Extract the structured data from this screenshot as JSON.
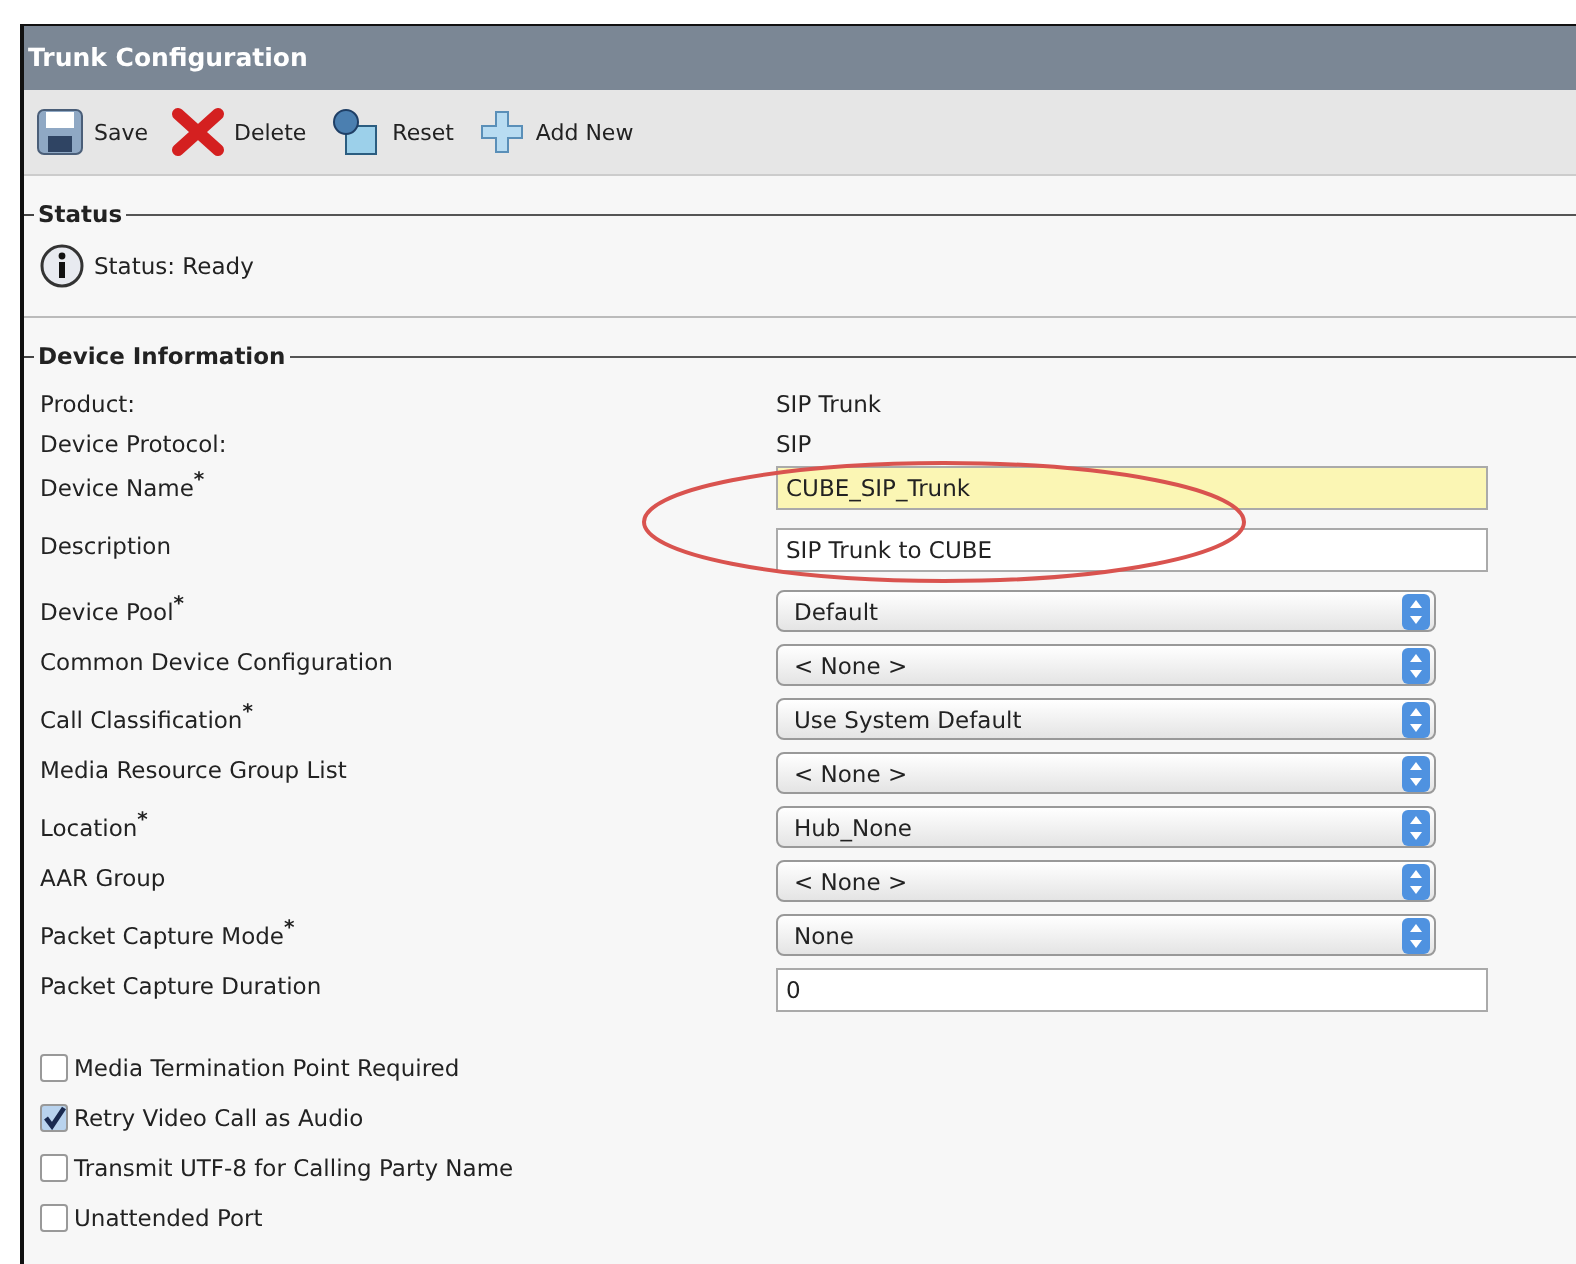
{
  "window": {
    "title": "Trunk Configuration"
  },
  "toolbar": [
    {
      "kind": "save",
      "label": "Save"
    },
    {
      "kind": "delete",
      "label": "Delete"
    },
    {
      "kind": "reset",
      "label": "Reset"
    },
    {
      "kind": "add",
      "label": "Add New"
    }
  ],
  "status": {
    "legend": "Status",
    "text": "Status: Ready"
  },
  "device_information": {
    "legend": "Device Information",
    "rows": [
      {
        "kind": "text",
        "label": "Product:",
        "value": "SIP Trunk"
      },
      {
        "kind": "text",
        "label": "Device Protocol:",
        "value": "SIP"
      },
      {
        "kind": "input",
        "label": "Device Name$^{*}$",
        "value": "CUBE_SIP_Trunk",
        "highlighted": true
      },
      {
        "kind": "input",
        "label": "Description",
        "value": "SIP Trunk to CUBE",
        "highlighted": false
      },
      {
        "kind": "select",
        "label": "Device Pool$^{*}$",
        "value": "Default"
      },
      {
        "kind": "select",
        "label": "Common Device Configuration",
        "value": "< None >"
      },
      {
        "kind": "select",
        "label": "Call Classification$^{*}$",
        "value": "Use System Default"
      },
      {
        "kind": "select",
        "label": "Media Resource Group List",
        "value": "< None >"
      },
      {
        "kind": "select",
        "label": "Location$^{*}$",
        "value": "Hub_None"
      },
      {
        "kind": "select",
        "label": "AAR Group",
        "value": "< None >"
      },
      {
        "kind": "select",
        "label": "Packet Capture Mode$^{*}$",
        "value": "None"
      },
      {
        "kind": "input",
        "label": "Packet Capture Duration",
        "value": "0",
        "highlighted": false
      }
    ],
    "checkboxes": [
      {
        "label": "Media Termination Point Required",
        "checked": false
      },
      {
        "label": "Retry Video Call as Audio",
        "checked": true
      },
      {
        "label": "Transmit UTF-8 for Calling Party Name",
        "checked": false
      },
      {
        "label": "Unattended Port",
        "checked": false
      }
    ]
  }
}
